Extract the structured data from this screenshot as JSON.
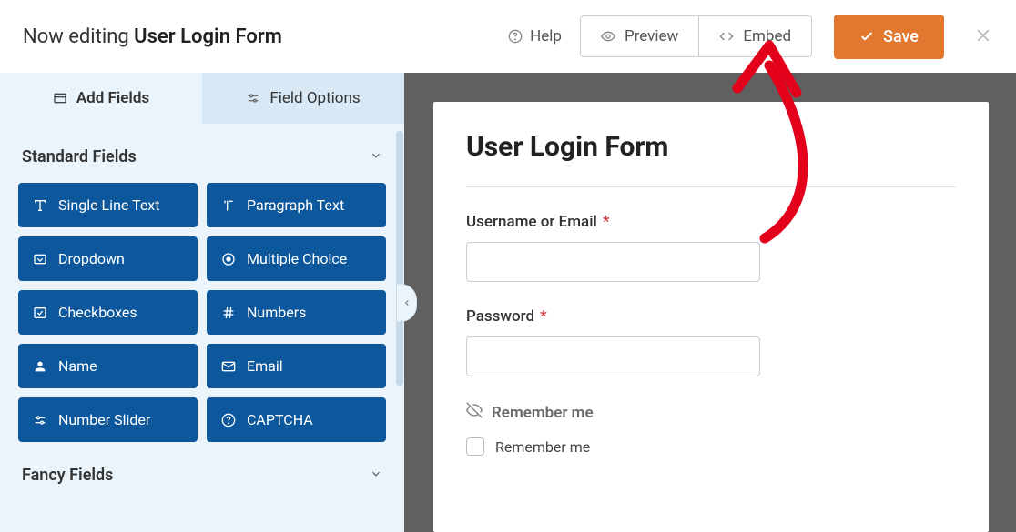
{
  "colors": {
    "accent_orange": "#e27730",
    "field_blue": "#0d579c"
  },
  "topbar": {
    "prefix": "Now editing ",
    "form_name": "User Login Form",
    "help": "Help",
    "preview": "Preview",
    "embed": "Embed",
    "save": "Save"
  },
  "tabs": {
    "add_fields": "Add Fields",
    "field_options": "Field Options"
  },
  "groups": {
    "standard": {
      "title": "Standard Fields",
      "fields": [
        "Single Line Text",
        "Paragraph Text",
        "Dropdown",
        "Multiple Choice",
        "Checkboxes",
        "Numbers",
        "Name",
        "Email",
        "Number Slider",
        "CAPTCHA"
      ]
    },
    "fancy": {
      "title": "Fancy Fields"
    }
  },
  "form_preview": {
    "title": "User Login Form",
    "username_label": "Username or Email",
    "password_label": "Password",
    "asterisk": "*",
    "remember_heading": "Remember me",
    "remember_option": "Remember me"
  }
}
